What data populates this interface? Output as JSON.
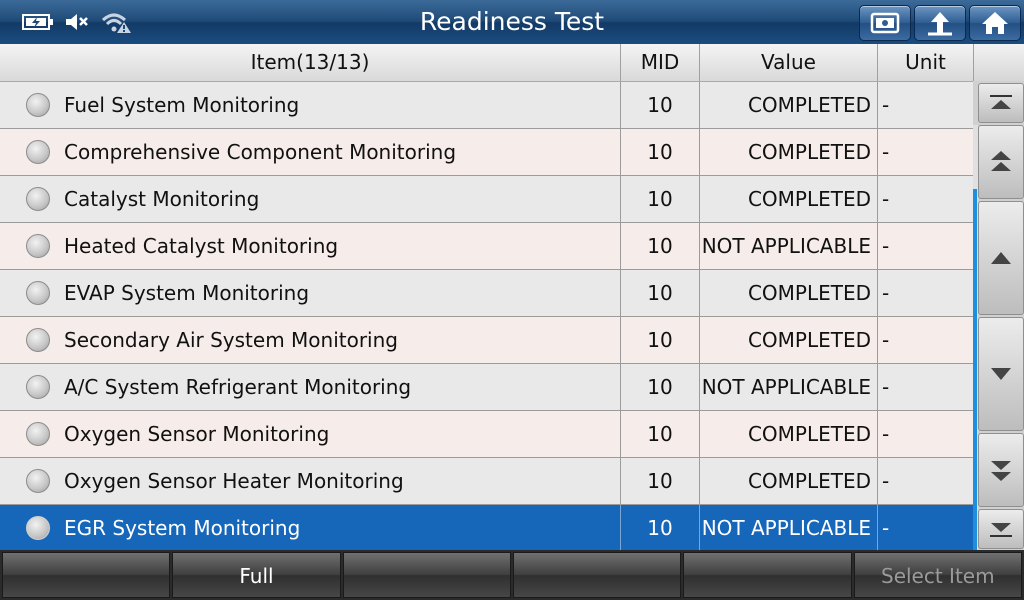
{
  "header": {
    "title": "Readiness Test",
    "status_icons": [
      "battery-charging-icon",
      "speaker-muted-icon",
      "wifi-warning-icon"
    ],
    "buttons": [
      "print-screen-icon",
      "back-up-icon",
      "home-icon"
    ]
  },
  "table": {
    "columns": {
      "item": "Item(13/13)",
      "mid": "MID",
      "value": "Value",
      "unit": "Unit"
    },
    "rows": [
      {
        "item": "Fuel System Monitoring",
        "mid": "10",
        "value": "COMPLETED",
        "unit": "-"
      },
      {
        "item": "Comprehensive Component Monitoring",
        "mid": "10",
        "value": "COMPLETED",
        "unit": "-"
      },
      {
        "item": "Catalyst Monitoring",
        "mid": "10",
        "value": "COMPLETED",
        "unit": "-"
      },
      {
        "item": "Heated Catalyst Monitoring",
        "mid": "10",
        "value": "NOT APPLICABLE",
        "unit": "-"
      },
      {
        "item": "EVAP System Monitoring",
        "mid": "10",
        "value": "COMPLETED",
        "unit": "-"
      },
      {
        "item": "Secondary Air System Monitoring",
        "mid": "10",
        "value": "COMPLETED",
        "unit": "-"
      },
      {
        "item": "A/C System Refrigerant Monitoring",
        "mid": "10",
        "value": "NOT APPLICABLE",
        "unit": "-"
      },
      {
        "item": "Oxygen Sensor Monitoring",
        "mid": "10",
        "value": "COMPLETED",
        "unit": "-"
      },
      {
        "item": "Oxygen Sensor Heater Monitoring",
        "mid": "10",
        "value": "COMPLETED",
        "unit": "-"
      },
      {
        "item": "EGR System Monitoring",
        "mid": "10",
        "value": "NOT APPLICABLE",
        "unit": "-"
      }
    ],
    "selected_index": 9
  },
  "scroll": {
    "buttons": [
      "scroll-top-icon",
      "page-up-icon",
      "line-up-icon",
      "line-down-icon",
      "page-down-icon",
      "scroll-bottom-icon"
    ]
  },
  "bottom": {
    "buttons": [
      {
        "label": "",
        "enabled": true
      },
      {
        "label": "Full",
        "enabled": true
      },
      {
        "label": "",
        "enabled": true
      },
      {
        "label": "",
        "enabled": true
      },
      {
        "label": "",
        "enabled": true
      },
      {
        "label": "Select Item",
        "enabled": false
      }
    ]
  },
  "colors": {
    "selected_row": "#1667b9",
    "scroll_thumb": "#1e8ee0",
    "header_bar": "#1f4a78"
  }
}
